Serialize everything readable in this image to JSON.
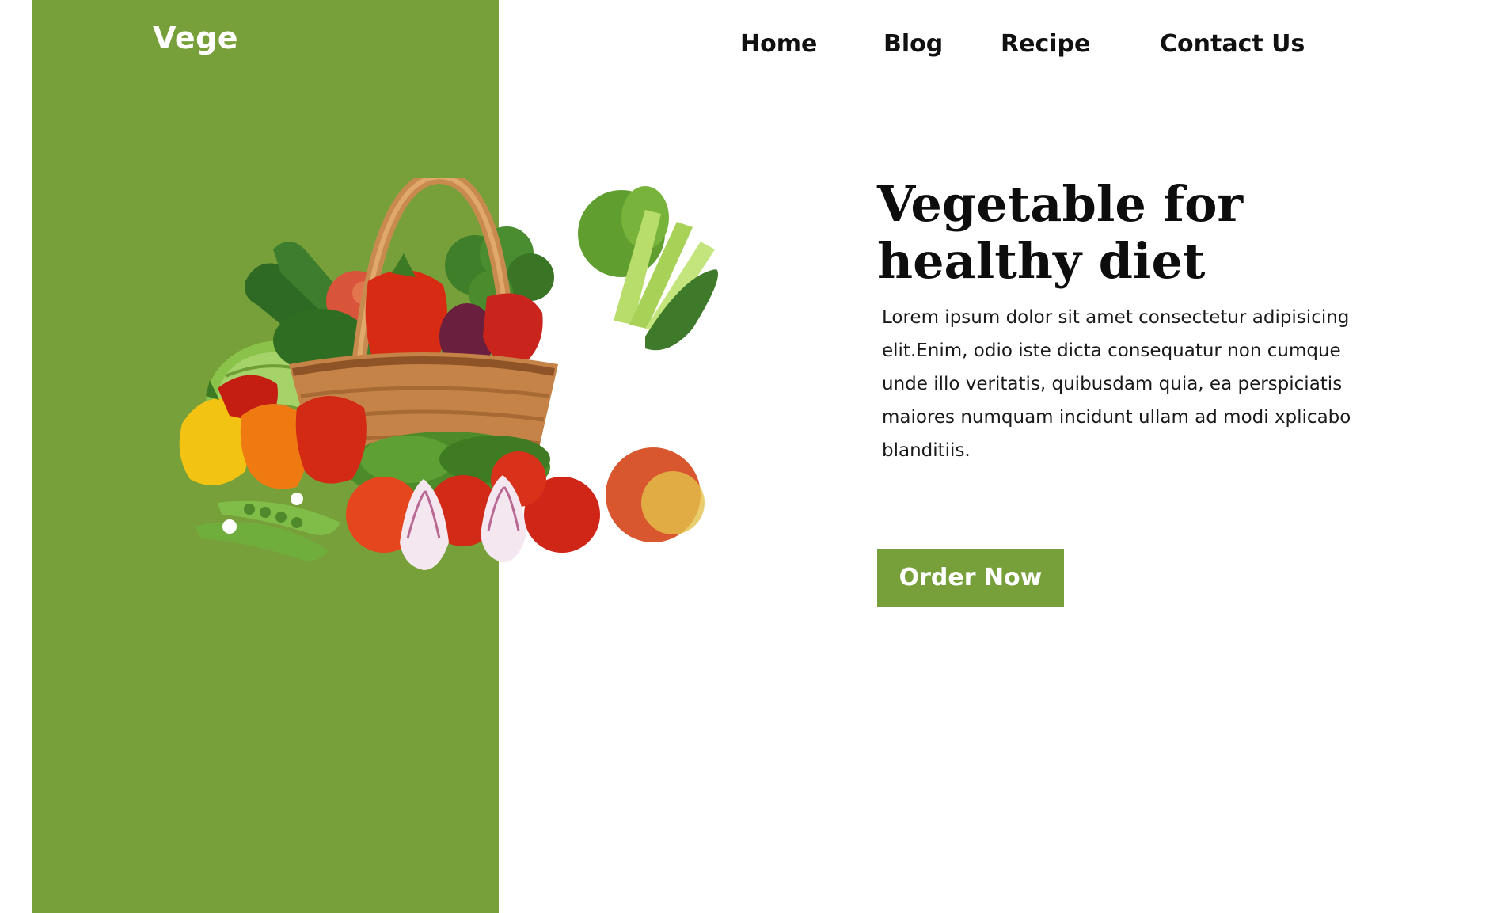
{
  "brand": {
    "logo": "Vege",
    "accent_color": "#77a03a"
  },
  "nav": {
    "items": [
      {
        "label": "Home"
      },
      {
        "label": "Blog"
      },
      {
        "label": "Recipe"
      },
      {
        "label": "Contact Us"
      }
    ]
  },
  "hero": {
    "title_line1": "Vegetable for",
    "title_line2": "healthy diet",
    "description_lines": [
      "Lorem ipsum dolor sit amet consectetur adipisicing",
      "elit.Enim, odio iste dicta consequatur non cumque",
      "unde illo veritatis, quibusdam quia, ea perspiciatis",
      "maiores numquam incidunt ullam ad modi xplicabo",
      "blanditiis."
    ],
    "cta_label": "Order Now",
    "image_icon": "vegetable-basket-image"
  }
}
